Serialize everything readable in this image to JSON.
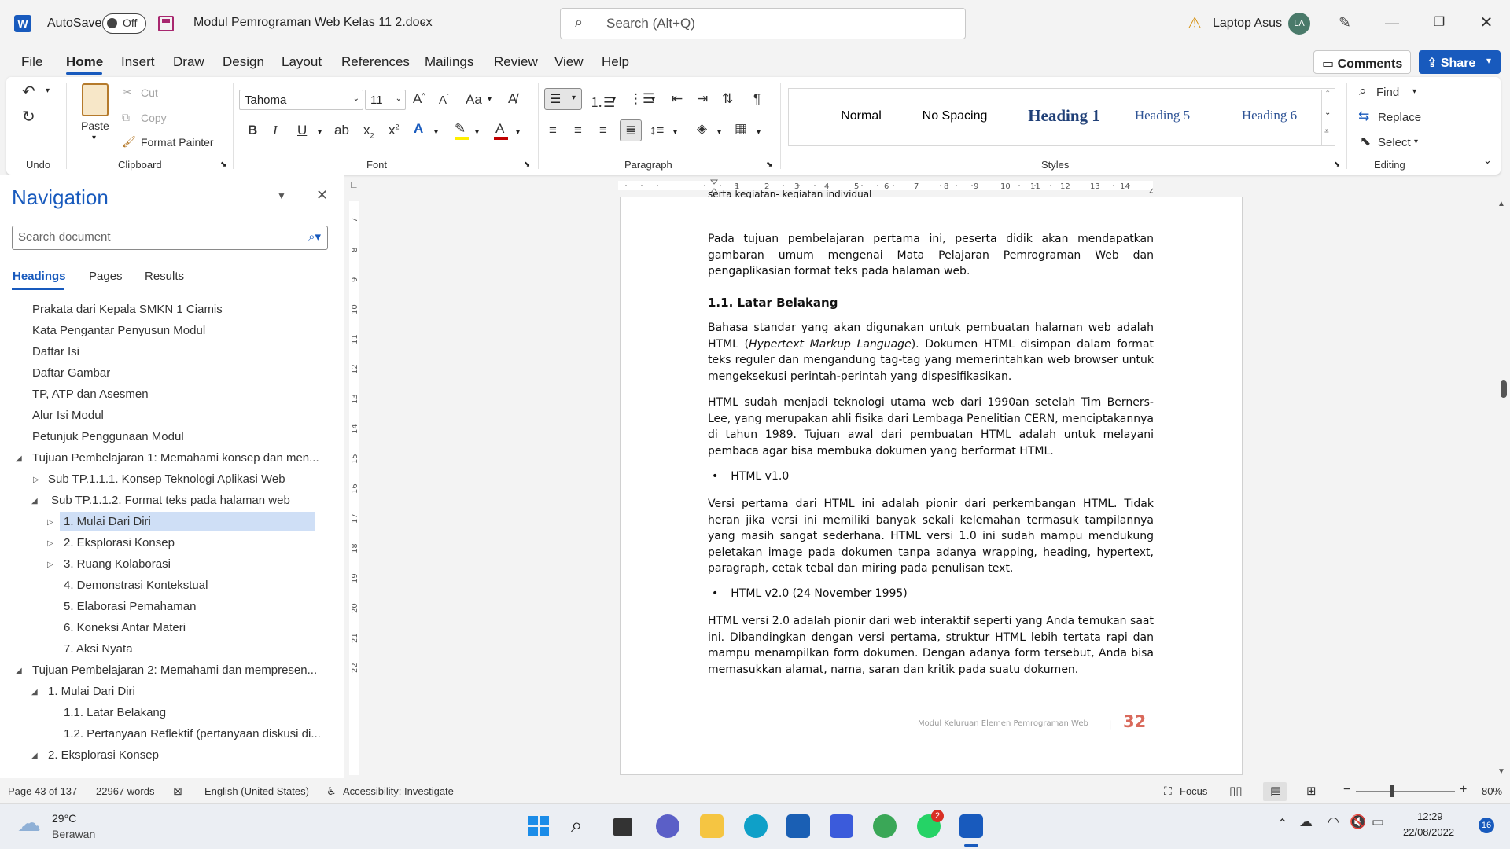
{
  "window": {
    "autosave_label": "AutoSave",
    "autosave_state": "Off",
    "doc_title": "Modul Pemrograman Web Kelas 11 2.docx",
    "search_placeholder": "Search (Alt+Q)",
    "account_name": "Laptop Asus",
    "account_initials": "LA"
  },
  "tabs": [
    "File",
    "Home",
    "Insert",
    "Draw",
    "Design",
    "Layout",
    "References",
    "Mailings",
    "Review",
    "View",
    "Help"
  ],
  "header_buttons": {
    "comments": "Comments",
    "share": "Share"
  },
  "ribbon": {
    "groups": {
      "undo": "Undo",
      "clipboard": "Clipboard",
      "font": "Font",
      "paragraph": "Paragraph",
      "styles": "Styles",
      "editing": "Editing"
    },
    "clipboard": {
      "paste": "Paste",
      "cut": "Cut",
      "copy": "Copy",
      "format_painter": "Format Painter"
    },
    "font_name": "Tahoma",
    "font_size": "11",
    "styles": [
      "Normal",
      "No Spacing",
      "Heading 1",
      "Heading 5",
      "Heading 6"
    ],
    "editing": {
      "find": "Find",
      "replace": "Replace",
      "select": "Select"
    }
  },
  "navigation": {
    "title": "Navigation",
    "search_placeholder": "Search document",
    "tabs": [
      "Headings",
      "Pages",
      "Results"
    ],
    "items": [
      "Prakata dari Kepala SMKN 1 Ciamis",
      "Kata Pengantar Penyusun Modul",
      "Daftar Isi",
      "Daftar Gambar",
      "TP, ATP dan Asesmen",
      "Alur Isi Modul",
      "Petunjuk Penggunaan Modul",
      "Tujuan Pembelajaran 1: Memahami konsep dan men...",
      "Sub TP.1.1.1. Konsep Teknologi Aplikasi Web",
      "Sub TP.1.1.2. Format teks pada halaman web",
      "1. Mulai Dari Diri",
      "2. Eksplorasi Konsep",
      "3.  Ruang Kolaborasi",
      "4. Demonstrasi Kontekstual",
      "5.  Elaborasi Pemahaman",
      "6. Koneksi Antar Materi",
      "7. Aksi Nyata",
      "Tujuan Pembelajaran 2: Memahami dan mempresen...",
      "1. Mulai Dari Diri",
      "1.1. Latar Belakang",
      "1.2. Pertanyaan Reflektif (pertanyaan diskusi di...",
      "2. Eksplorasi Konsep"
    ]
  },
  "document": {
    "top_cut": "serta kegiatan- kegiatan individual",
    "p_intro": "Pada tujuan pembelajaran pertama ini, peserta didik akan mendapatkan gambaran umum mengenai Mata Pelajaran Pemrograman Web dan pengaplikasian format teks pada halaman web.",
    "heading": "1.1.  Latar Belakang",
    "p1_a": "Bahasa standar yang akan digunakan untuk pembuatan halaman web adalah HTML (",
    "p1_em": "Hypertext Markup Language",
    "p1_b": "). Dokumen HTML disimpan dalam format teks reguler dan mengandung tag-tag yang memerintahkan web browser untuk mengeksekusi perintah-perintah yang dispesifikasikan.",
    "p2": "HTML sudah menjadi teknologi utama web dari 1990an setelah Tim Berners-Lee, yang merupakan ahli fisika dari Lembaga Penelitian CERN, menciptakannya di tahun 1989. Tujuan awal dari pembuatan HTML adalah untuk melayani pembaca agar bisa membuka dokumen yang berformat HTML.",
    "bullet1": "HTML v1.0",
    "p3": "Versi pertama dari HTML ini adalah pionir dari perkembangan HTML. Tidak heran jika versi ini memiliki banyak sekali kelemahan termasuk tampilannya yang masih sangat sederhana. HTML versi 1.0 ini sudah mampu mendukung peletakan image pada dokumen tanpa adanya wrapping, heading, hypertext, paragraph, cetak tebal dan miring pada penulisan text.",
    "bullet2": "HTML v2.0 (24 November 1995)",
    "p4": "HTML versi 2.0 adalah pionir dari web interaktif seperti yang Anda temukan saat ini. Dibandingkan dengan versi pertama, struktur HTML lebih tertata rapi dan mampu menampilkan form dokumen. Dengan adanya form tersebut, Anda bisa memasukkan alamat, nama, saran dan kritik pada suatu dokumen.",
    "footer_text": "Modul Keluruan Elemen Pemrograman Web",
    "footer_sep": "|",
    "page_number": "32"
  },
  "status": {
    "page": "Page 43 of 137",
    "words": "22967 words",
    "language": "English (United States)",
    "accessibility": "Accessibility: Investigate",
    "focus": "Focus",
    "zoom": "80%"
  },
  "taskbar": {
    "temperature": "29°C",
    "weather": "Berawan",
    "time": "12:29",
    "date": "22/08/2022",
    "notif_count": "16",
    "whatsapp_badge": "2"
  },
  "colors": {
    "accent": "#185abd",
    "page_number": "#d9695b",
    "selection": "#cfdff6"
  }
}
